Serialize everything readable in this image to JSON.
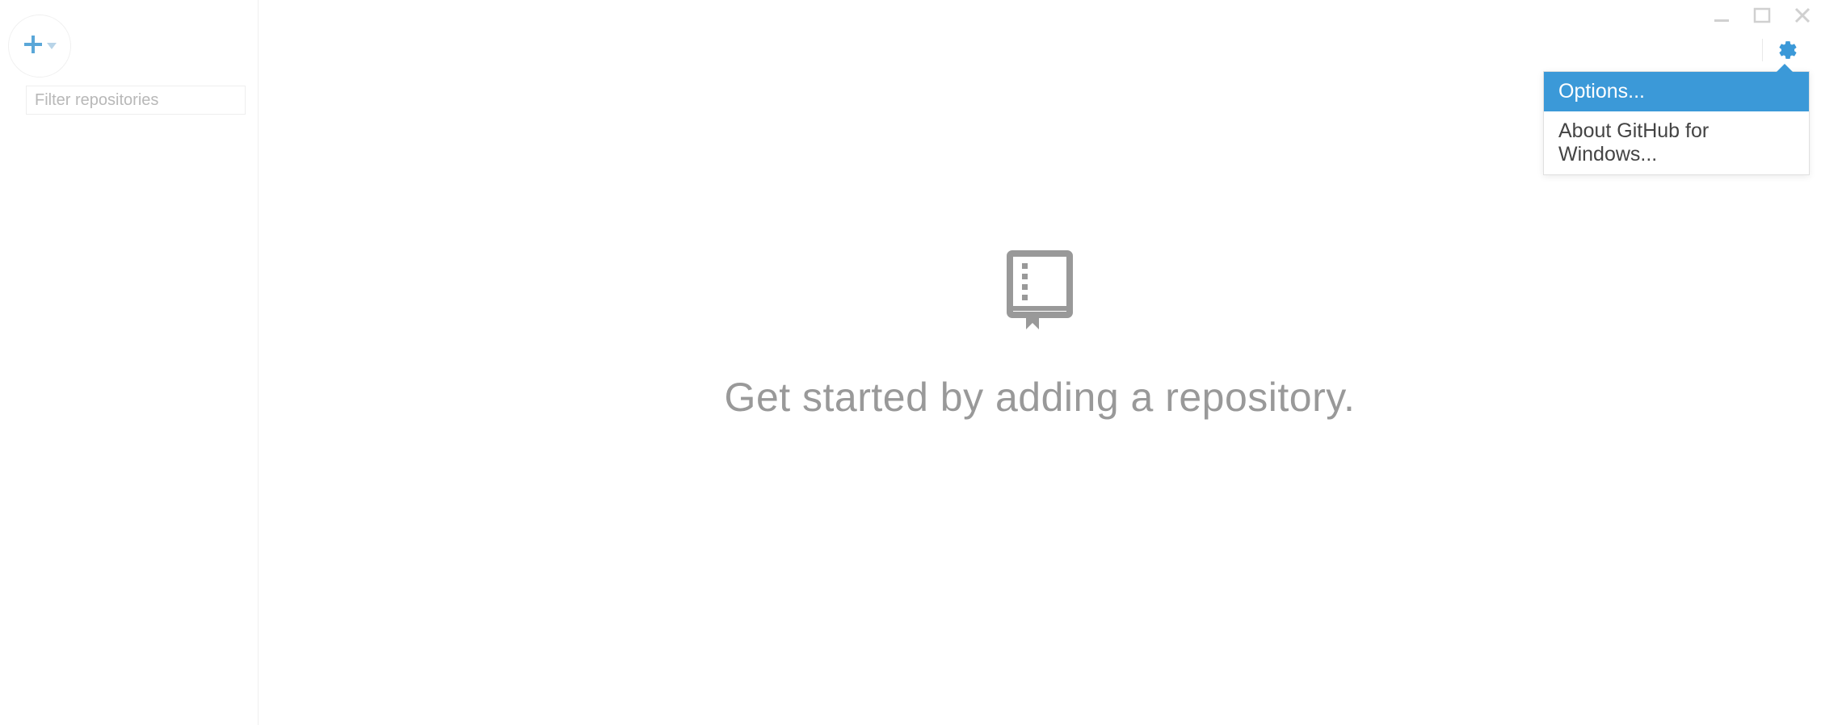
{
  "sidebar": {
    "filter_placeholder": "Filter repositories"
  },
  "header": {
    "gear_menu": {
      "items": [
        {
          "label": "Options...",
          "selected": true
        },
        {
          "label": "About GitHub for Windows...",
          "selected": false
        }
      ]
    }
  },
  "main": {
    "empty_state_text": "Get started by adding a repository."
  },
  "colors": {
    "accent": "#3b99d8",
    "muted_text": "#999999",
    "border": "#f0f0f0"
  }
}
